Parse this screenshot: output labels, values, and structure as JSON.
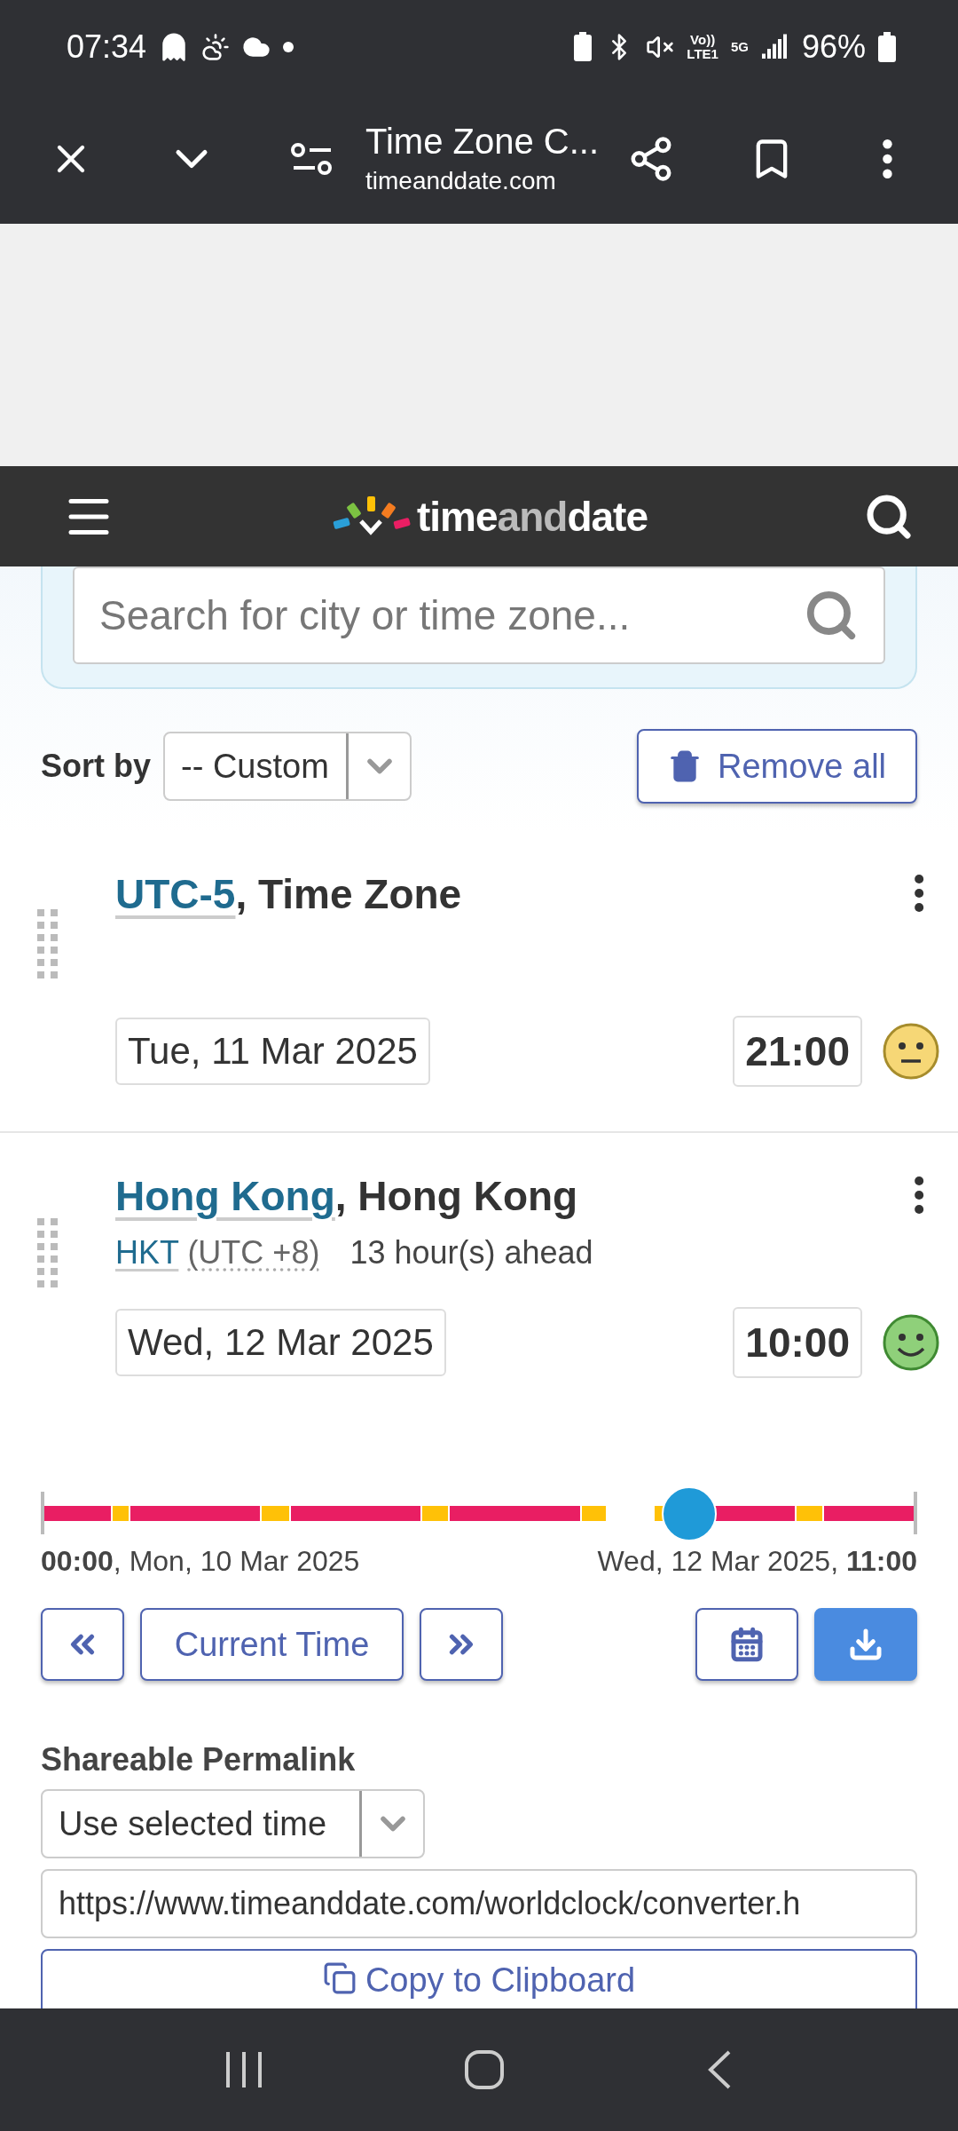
{
  "status_bar": {
    "time": "07:34",
    "network_voice": "Vo))",
    "network_lte": "LTE1",
    "network_5g": "5G",
    "battery": "96%"
  },
  "browser_toolbar": {
    "title": "Time Zone C...",
    "url": "timeanddate.com"
  },
  "site_header": {
    "logo": "time**and**date"
  },
  "search": {
    "placeholder": "Search for city or time zone..."
  },
  "sort": {
    "label": "Sort by",
    "value": "-- Custom",
    "remove_all": "Remove all"
  },
  "locations": [
    {
      "link": "UTC-5",
      "rest": ", Time Zone",
      "date": "Tue, 11 Mar 2025",
      "time": "21:00",
      "kind": "neutral"
    },
    {
      "link": "Hong Kong",
      "rest": ", Hong Kong",
      "abbr": "HKT",
      "offset": "(UTC +8)",
      "difference": "13 hour(s) ahead",
      "date": "Wed, 12 Mar 2025",
      "time": "10:00",
      "kind": "happy"
    }
  ],
  "timeline": {
    "level": 0.74,
    "start_label": "**00:00**, Mon, 10 Mar 2025",
    "end_label": "Wed, 12 Mar 2025, **11:00**"
  },
  "controls": {
    "current_time": "Current Time"
  },
  "permalink": {
    "heading": "Shareable Permalink",
    "mode": "Use selected time",
    "url": "https://www.timeanddate.com/worldclock/converter.h",
    "copy": "Copy to Clipboard"
  }
}
